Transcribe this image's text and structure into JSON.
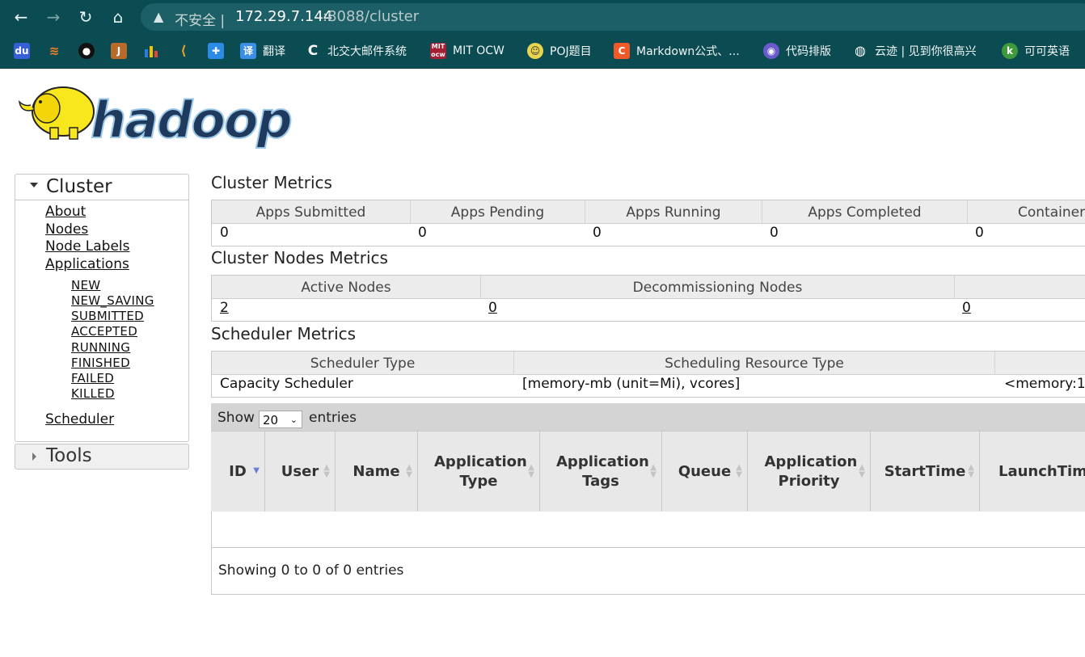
{
  "browser": {
    "insecure_label": "不安全 |",
    "url_host": "172.29.7.144",
    "url_path": ":8088/cluster"
  },
  "bookmarks": [
    {
      "icon": "baidu-icon",
      "label": ""
    },
    {
      "icon": "stackoverflow-icon",
      "label": ""
    },
    {
      "icon": "github-icon",
      "label": ""
    },
    {
      "icon": "j-icon",
      "label": ""
    },
    {
      "icon": "chart-icon",
      "label": ""
    },
    {
      "icon": "leetcode-icon",
      "label": ""
    },
    {
      "icon": "app-icon",
      "label": ""
    },
    {
      "icon": "translate-icon",
      "label": "翻译"
    },
    {
      "icon": "c-icon",
      "label": "北交大邮件系统"
    },
    {
      "icon": "mit-icon",
      "label": "MIT OCW"
    },
    {
      "icon": "poj-icon",
      "label": "POJ题目"
    },
    {
      "icon": "csdn-icon",
      "label": "Markdown公式、..."
    },
    {
      "icon": "code-icon",
      "label": "代码排版"
    },
    {
      "icon": "globe-icon",
      "label": "云迹 | 见到你很高兴"
    },
    {
      "icon": "keke-icon",
      "label": "可可英语"
    }
  ],
  "sidebar": {
    "cluster_label": "Cluster",
    "links": [
      "About",
      "Nodes",
      "Node Labels",
      "Applications"
    ],
    "app_states": [
      "NEW",
      "NEW_SAVING",
      "SUBMITTED",
      "ACCEPTED",
      "RUNNING",
      "FINISHED",
      "FAILED",
      "KILLED"
    ],
    "scheduler_label": "Scheduler",
    "tools_label": "Tools"
  },
  "cluster_metrics": {
    "title": "Cluster Metrics",
    "headers": [
      "Apps Submitted",
      "Apps Pending",
      "Apps Running",
      "Apps Completed",
      "Container"
    ],
    "values": [
      "0",
      "0",
      "0",
      "0",
      "0"
    ]
  },
  "nodes_metrics": {
    "title": "Cluster Nodes Metrics",
    "headers": [
      "Active Nodes",
      "Decommissioning Nodes",
      ""
    ],
    "values": [
      "2",
      "0",
      "0"
    ]
  },
  "scheduler_metrics": {
    "title": "Scheduler Metrics",
    "headers": [
      "Scheduler Type",
      "Scheduling Resource Type",
      ""
    ],
    "values": [
      "Capacity Scheduler",
      "[memory-mb (unit=Mi), vcores]",
      "<memory:1"
    ]
  },
  "apps_table": {
    "show_label": "Show",
    "page_size": "20",
    "entries_label": "entries",
    "columns": [
      "ID",
      "User",
      "Name",
      "Application Type",
      "Application Tags",
      "Queue",
      "Application Priority",
      "StartTime",
      "LaunchTime"
    ],
    "info": "Showing 0 to 0 of 0 entries"
  },
  "colors": {
    "chrome": "#0b4b52",
    "header_bg": "#ececec",
    "logo_yellow": "#f8e71c",
    "logo_blue": "#1f3a5c"
  }
}
